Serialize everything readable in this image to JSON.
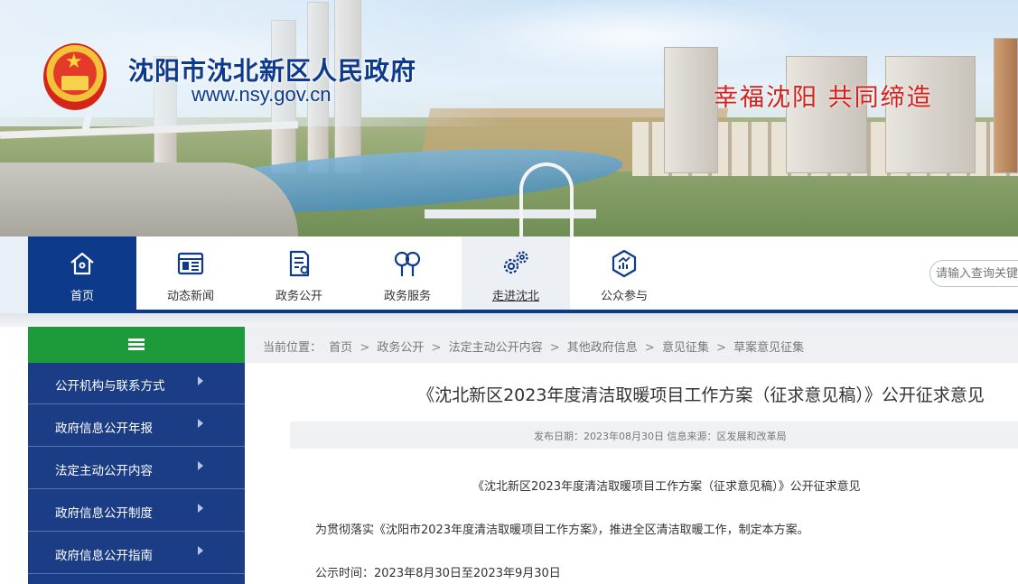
{
  "header": {
    "site_title": "沈阳市沈北新区人民政府",
    "site_url": "www.nsy.gov.cn",
    "slogan": "幸福沈阳 共同缔造",
    "emblem_icon": "national-emblem-icon"
  },
  "nav": {
    "items": [
      {
        "label": "首页",
        "icon": "home-icon",
        "state": "active"
      },
      {
        "label": "动态新闻",
        "icon": "news-icon"
      },
      {
        "label": "政务公开",
        "icon": "document-icon"
      },
      {
        "label": "政务服务",
        "icon": "service-icon"
      },
      {
        "label": "走进沈北",
        "icon": "gears-icon",
        "state": "hovered"
      },
      {
        "label": "公众参与",
        "icon": "chart-icon"
      }
    ],
    "search_placeholder": "请输入查询关键字",
    "active_color": "#0d3a8a"
  },
  "sidebar": {
    "header_color": "#1d9a3a",
    "items": [
      {
        "label": "公开机构与联系方式"
      },
      {
        "label": "政府信息公开年报"
      },
      {
        "label": "法定主动公开内容"
      },
      {
        "label": "政府信息公开制度"
      },
      {
        "label": "政府信息公开指南"
      }
    ]
  },
  "breadcrumb": {
    "prefix": "当前位置：",
    "items": [
      "首页",
      "政务公开",
      "法定主动公开内容",
      "其他政府信息",
      "意见征集",
      "草案意见征集"
    ],
    "separator": ">"
  },
  "article": {
    "title": "《沈北新区2023年度清洁取暖项目工作方案（征求意见稿）》公开征求意见",
    "meta": "发布日期：2023年08月30日 信息来源：区发展和改革局",
    "paragraphs": [
      "《沈北新区2023年度清洁取暖项目工作方案（征求意见稿）》公开征求意见",
      "为贯彻落实《沈阳市2023年度清洁取暖项目工作方案》，推进全区清洁取暖工作，制定本方案。",
      "公示时间：2023年8月30日至2023年9月30日"
    ]
  }
}
